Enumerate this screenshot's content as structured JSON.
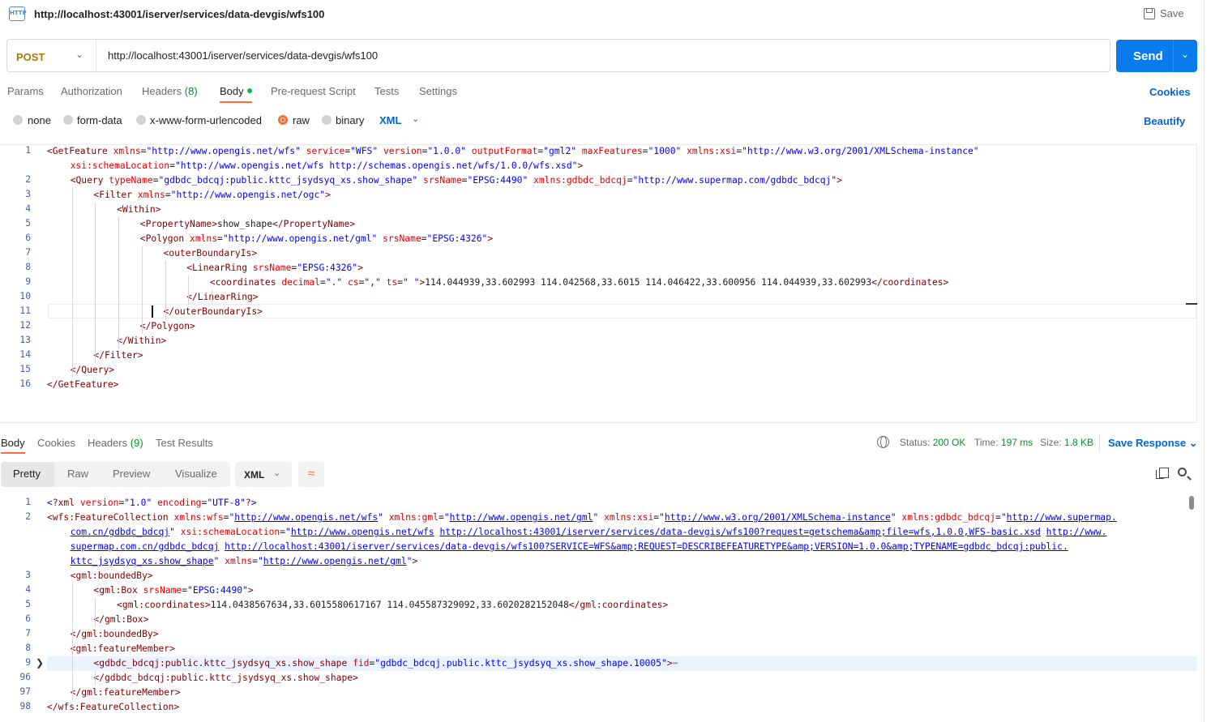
{
  "header": {
    "icon": "http-request-icon",
    "title": "http://localhost:43001/iserver/services/data-devgis/wfs100",
    "save_label": "Save"
  },
  "request": {
    "method": "POST",
    "url": "http://localhost:43001/iserver/services/data-devgis/wfs100",
    "send_label": "Send"
  },
  "request_tabs": {
    "params": "Params",
    "authorization": "Authorization",
    "headers": "Headers",
    "headers_count": "(8)",
    "body": "Body",
    "prerequest": "Pre-request Script",
    "tests": "Tests",
    "settings": "Settings",
    "cookies": "Cookies"
  },
  "body_types": {
    "none": "none",
    "form_data": "form-data",
    "urlencoded": "x-www-form-urlencoded",
    "raw": "raw",
    "binary": "binary",
    "selected": "raw",
    "language": "XML",
    "beautify": "Beautify"
  },
  "request_body_line_numbers": [
    "1",
    "2",
    "3",
    "4",
    "5",
    "6",
    "7",
    "8",
    "9",
    "10",
    "11",
    "12",
    "13",
    "14",
    "15",
    "16"
  ],
  "request_body_lines": [
    [
      [
        "t",
        "<GetFeature "
      ],
      [
        "a",
        "xmlns"
      ],
      [
        "p",
        "="
      ],
      [
        "s",
        "\"http://www.opengis.net/wfs\""
      ],
      [
        "p",
        " "
      ],
      [
        "a",
        "service"
      ],
      [
        "p",
        "="
      ],
      [
        "s",
        "\"WFS\""
      ],
      [
        "p",
        " "
      ],
      [
        "a",
        "version"
      ],
      [
        "p",
        "="
      ],
      [
        "s",
        "\"1.0.0\""
      ],
      [
        "p",
        " "
      ],
      [
        "a",
        "outputFormat"
      ],
      [
        "p",
        "="
      ],
      [
        "s",
        "\"gml2\""
      ],
      [
        "p",
        " "
      ],
      [
        "a",
        "maxFeatures"
      ],
      [
        "p",
        "="
      ],
      [
        "s",
        "\"1000\""
      ],
      [
        "p",
        " "
      ],
      [
        "a",
        "xmlns:xsi"
      ],
      [
        "p",
        "="
      ],
      [
        "s",
        "\"http://www.w3.org/2001/XMLSchema-instance\""
      ]
    ],
    [
      [
        "a",
        "xsi:schemaLocation"
      ],
      [
        "p",
        "="
      ],
      [
        "s",
        "\"http://www.opengis.net/wfs http://schemas.opengis.net/wfs/1.0.0/wfs.xsd\""
      ],
      [
        "t",
        ">"
      ]
    ],
    [
      [
        "t",
        "<Query "
      ],
      [
        "a",
        "typeName"
      ],
      [
        "p",
        "="
      ],
      [
        "s",
        "\"gdbdc_bdcqj:public.kttc_jsydsyq_xs.show_shape\""
      ],
      [
        "p",
        " "
      ],
      [
        "a",
        "srsName"
      ],
      [
        "p",
        "="
      ],
      [
        "s",
        "\"EPSG:4490\""
      ],
      [
        "p",
        " "
      ],
      [
        "a",
        "xmlns:gdbdc_bdcqj"
      ],
      [
        "p",
        "="
      ],
      [
        "s",
        "\"http://www.supermap.com/gdbdc_bdcqj\""
      ],
      [
        "t",
        ">"
      ]
    ],
    [
      [
        "t",
        "<Filter "
      ],
      [
        "a",
        "xmlns"
      ],
      [
        "p",
        "="
      ],
      [
        "s",
        "\"http://www.opengis.net/ogc\""
      ],
      [
        "t",
        ">"
      ]
    ],
    [
      [
        "t",
        "<Within>"
      ]
    ],
    [
      [
        "t",
        "<PropertyName>"
      ],
      [
        "p",
        "show_shape"
      ],
      [
        "t",
        "</PropertyName>"
      ]
    ],
    [
      [
        "t",
        "<Polygon "
      ],
      [
        "a",
        "xmlns"
      ],
      [
        "p",
        "="
      ],
      [
        "s",
        "\"http://www.opengis.net/gml\""
      ],
      [
        "p",
        " "
      ],
      [
        "a",
        "srsName"
      ],
      [
        "p",
        "="
      ],
      [
        "s",
        "\"EPSG:4326\""
      ],
      [
        "t",
        ">"
      ]
    ],
    [
      [
        "t",
        "<outerBoundaryIs>"
      ]
    ],
    [
      [
        "t",
        "<LinearRing "
      ],
      [
        "a",
        "srsName"
      ],
      [
        "p",
        "="
      ],
      [
        "s",
        "\"EPSG:4326\""
      ],
      [
        "t",
        ">"
      ]
    ],
    [
      [
        "t",
        "<coordinates "
      ],
      [
        "a",
        "decimal"
      ],
      [
        "p",
        "="
      ],
      [
        "s",
        "\".\""
      ],
      [
        "p",
        " "
      ],
      [
        "a",
        "cs"
      ],
      [
        "p",
        "="
      ],
      [
        "s",
        "\",\""
      ],
      [
        "p",
        " "
      ],
      [
        "a",
        "ts"
      ],
      [
        "p",
        "="
      ],
      [
        "s",
        "\" \""
      ],
      [
        "t",
        ">"
      ],
      [
        "p",
        "114.044939,33.602993 114.042568,33.6015 114.046422,33.600956 114.044939,33.602993"
      ],
      [
        "t",
        "</coordinates>"
      ]
    ],
    [
      [
        "t",
        "</LinearRing>"
      ]
    ],
    [
      [
        "t",
        "</outerBoundaryIs>"
      ]
    ],
    [
      [
        "t",
        "</Polygon>"
      ]
    ],
    [
      [
        "t",
        "</Within>"
      ]
    ],
    [
      [
        "t",
        "</Filter>"
      ]
    ],
    [
      [
        "t",
        "</Query>"
      ]
    ],
    [
      [
        "t",
        "</GetFeature>"
      ]
    ]
  ],
  "response_tabs": {
    "body": "Body",
    "cookies": "Cookies",
    "headers": "Headers",
    "headers_count": "(9)",
    "test_results": "Test Results"
  },
  "response_status": {
    "status_label": "Status:",
    "status_value": "200 OK",
    "time_label": "Time:",
    "time_value": "197 ms",
    "size_label": "Size:",
    "size_value": "1.8 KB",
    "save_response": "Save Response"
  },
  "response_view": {
    "pretty": "Pretty",
    "raw": "Raw",
    "preview": "Preview",
    "visualize": "Visualize",
    "format": "XML",
    "selected": "Pretty"
  },
  "response_line_numbers": [
    "1",
    "2",
    "3",
    "4",
    "5",
    "6",
    "7",
    "8",
    "9",
    "96",
    "97",
    "98"
  ],
  "response_lines": [
    [
      [
        "s",
        "<"
      ],
      [
        "t",
        "?xml "
      ],
      [
        "a",
        "version"
      ],
      [
        "p",
        "="
      ],
      [
        "s",
        "\"1.0\""
      ],
      [
        "p",
        " "
      ],
      [
        "a",
        "encoding"
      ],
      [
        "p",
        "="
      ],
      [
        "s",
        "\"UTF-8\""
      ],
      [
        "t",
        "?"
      ],
      [
        "s",
        ">"
      ]
    ],
    [
      [
        "t",
        "<wfs:FeatureCollection "
      ],
      [
        "a",
        "xmlns:wfs"
      ],
      [
        "p",
        "="
      ],
      [
        "s",
        "\""
      ],
      [
        "u",
        "http://www.opengis.net/wfs"
      ],
      [
        "s",
        "\""
      ],
      [
        "p",
        " "
      ],
      [
        "a",
        "xmlns:gml"
      ],
      [
        "p",
        "="
      ],
      [
        "s",
        "\""
      ],
      [
        "u",
        "http://www.opengis.net/gml"
      ],
      [
        "s",
        "\""
      ],
      [
        "p",
        " "
      ],
      [
        "a",
        "xmlns:xsi"
      ],
      [
        "p",
        "="
      ],
      [
        "s",
        "\""
      ],
      [
        "u",
        "http://www.w3.org/2001/XMLSchema-instance"
      ],
      [
        "s",
        "\""
      ],
      [
        "p",
        " "
      ],
      [
        "a",
        "xmlns:gdbdc_bdcqj"
      ],
      [
        "p",
        "="
      ],
      [
        "s",
        "\""
      ],
      [
        "u",
        "http://www.supermap."
      ]
    ],
    [
      [
        "u",
        "com.cn/gdbdc_bdcqj"
      ],
      [
        "s",
        "\""
      ],
      [
        "p",
        " "
      ],
      [
        "a",
        "xsi:schemaLocation"
      ],
      [
        "p",
        "="
      ],
      [
        "s",
        "\""
      ],
      [
        "u",
        "http://www.opengis.net/wfs"
      ],
      [
        "p",
        " "
      ],
      [
        "u",
        "http://localhost:43001/iserver/services/data-devgis/wfs100?request=getschema&amp;file=wfs,1.0.0,WFS-basic.xsd"
      ],
      [
        "p",
        " "
      ],
      [
        "u",
        "http://www."
      ]
    ],
    [
      [
        "u",
        "supermap.com.cn/gdbdc_bdcqj"
      ],
      [
        "p",
        " "
      ],
      [
        "u",
        "http://localhost:43001/iserver/services/data-devgis/wfs100?SERVICE=WFS&amp;REQUEST=DESCRIBEFEATURETYPE&amp;VERSION=1.0.0&amp;TYPENAME=gdbdc_bdcqj:public."
      ]
    ],
    [
      [
        "u",
        "kttc_jsydsyq_xs.show_shape"
      ],
      [
        "s",
        "\""
      ],
      [
        "p",
        " "
      ],
      [
        "a",
        "xmlns"
      ],
      [
        "p",
        "="
      ],
      [
        "s",
        "\""
      ],
      [
        "u",
        "http://www.opengis.net/gml"
      ],
      [
        "s",
        "\""
      ],
      [
        "t",
        ">"
      ]
    ],
    [
      [
        "t",
        "<gml:boundedBy>"
      ]
    ],
    [
      [
        "t",
        "<gml:Box "
      ],
      [
        "a",
        "srsName"
      ],
      [
        "p",
        "="
      ],
      [
        "s",
        "\"EPSG:4490\""
      ],
      [
        "t",
        ">"
      ]
    ],
    [
      [
        "t",
        "<gml:coordinates>"
      ],
      [
        "p",
        "114.0438567634,33.6015580617167 114.045587329092,33.6020282152048"
      ],
      [
        "t",
        "</gml:coordinates>"
      ]
    ],
    [
      [
        "t",
        "</gml:Box>"
      ]
    ],
    [
      [
        "t",
        "</gml:boundedBy>"
      ]
    ],
    [
      [
        "t",
        "<gml:featureMember>"
      ]
    ],
    [
      [
        "t",
        "<gdbdc_bdcqj:public.kttc_jsydsyq_xs.show_shape "
      ],
      [
        "a",
        "fid"
      ],
      [
        "p",
        "="
      ],
      [
        "s",
        "\"gdbdc_bdcqj.public.kttc_jsydsyq_xs.show_shape.10005\""
      ],
      [
        "t",
        ">"
      ],
      [
        "e",
        "⋯"
      ]
    ],
    [
      [
        "t",
        "</gdbdc_bdcqj:public.kttc_jsydsyq_xs.show_shape>"
      ]
    ],
    [
      [
        "t",
        "</gml:featureMember>"
      ]
    ],
    [
      [
        "t",
        "</wfs:FeatureCollection>"
      ]
    ]
  ]
}
